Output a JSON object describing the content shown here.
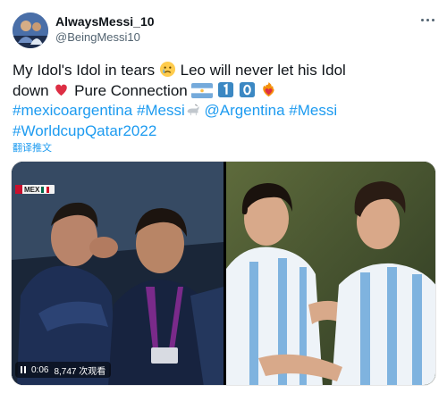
{
  "tweet": {
    "display_name": "AlwaysMessi_10",
    "handle": "@BeingMessi10",
    "text_lines": {
      "l1": {
        "a": "My Idol's Idol in tears",
        "b": "Leo will never let his Idol"
      },
      "l2": {
        "a": "down",
        "b": "Pure Connection"
      },
      "l3": {
        "tag1": "#mexicoargentina",
        "tag2": "#Messi",
        "mention": "@Argentina",
        "tag3": "#Messi"
      },
      "l4": {
        "tag": "#WorldcupQatar2022"
      }
    },
    "translate_label": "翻译推文",
    "emojis": {
      "crying": "crying-face-icon",
      "heart": "red-heart-icon",
      "flag": "argentina-flag-icon",
      "keycap_1": "keycap-1-icon",
      "keycap_0": "keycap-0-icon",
      "heart_fire": "heart-on-fire-icon",
      "goat": "goat-icon"
    },
    "colors": {
      "link": "#1d9bf0",
      "text": "#0f1419",
      "muted": "#536471"
    }
  },
  "media": {
    "video": {
      "scorebug_team": "MEX",
      "time": "0:06",
      "views": "8,747 次观看"
    }
  }
}
